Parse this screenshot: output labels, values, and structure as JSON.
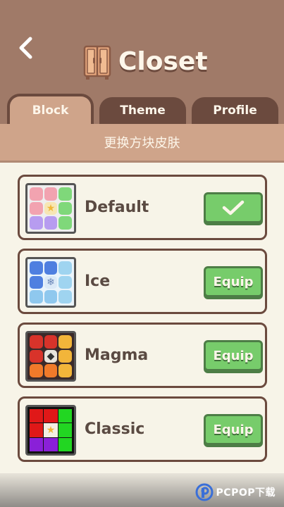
{
  "header": {
    "title": "Closet"
  },
  "tabs": [
    {
      "label": "Block",
      "active": true
    },
    {
      "label": "Theme",
      "active": false
    },
    {
      "label": "Profile",
      "active": false
    }
  ],
  "subtitle": "更换方块皮肤",
  "skins": [
    {
      "name": "Default",
      "action": "equipped",
      "button_icon": "checkmark-icon"
    },
    {
      "name": "Ice",
      "action": "Equip"
    },
    {
      "name": "Magma",
      "action": "Equip"
    },
    {
      "name": "Classic",
      "action": "Equip"
    }
  ],
  "watermark": "PCPOP下载",
  "colors": {
    "header_bg": "#a07a68",
    "tab_dark": "#6b4a3e",
    "tab_active": "#cfa48a",
    "button_green": "#77cc6b",
    "card_bg": "#f7f4e8"
  }
}
